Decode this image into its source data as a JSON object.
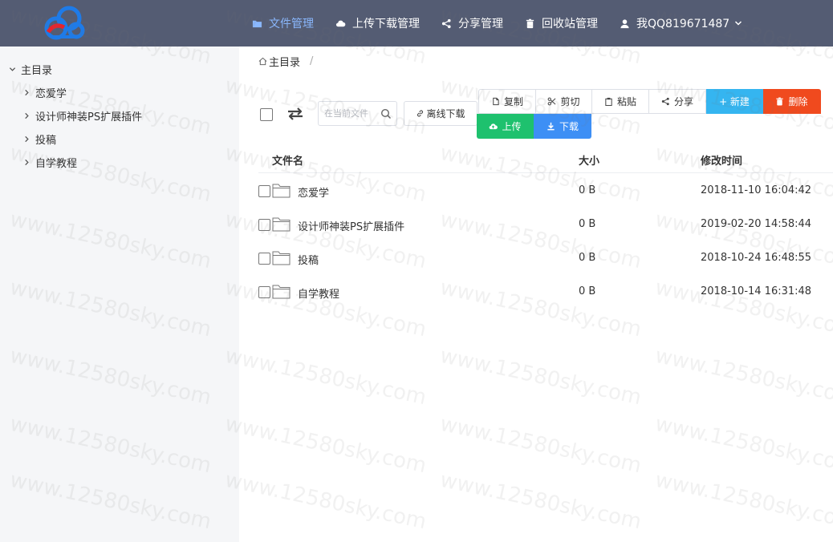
{
  "nav": {
    "items": [
      {
        "label": "文件管理",
        "icon": "folder-icon",
        "active": true
      },
      {
        "label": "上传下载管理",
        "icon": "cloud-icon",
        "active": false
      },
      {
        "label": "分享管理",
        "icon": "share-icon",
        "active": false
      },
      {
        "label": "回收站管理",
        "icon": "trash-icon",
        "active": false
      },
      {
        "label": "我QQ819671487",
        "icon": "user-icon",
        "active": false
      }
    ]
  },
  "sidebar": {
    "root": "主目录",
    "items": [
      {
        "label": "恋爱学"
      },
      {
        "label": "设计师神装PS扩展插件"
      },
      {
        "label": "投稿"
      },
      {
        "label": "自学教程"
      }
    ]
  },
  "breadcrumb": {
    "root": "主目录",
    "separator": "/"
  },
  "search": {
    "placeholder": "在当前文件"
  },
  "offline": {
    "label": "离线下载"
  },
  "toolbar": {
    "copy": "复制",
    "cut": "剪切",
    "paste": "粘贴",
    "share": "分享",
    "new": "+ 新建",
    "delete": "删除",
    "upload": "上传",
    "download": "下载"
  },
  "table": {
    "headers": {
      "name": "文件名",
      "size": "大小",
      "time": "修改时间"
    },
    "rows": [
      {
        "name": "恋爱学",
        "size": "0 B",
        "time": "2018-11-10 16:04:42"
      },
      {
        "name": "设计师神装PS扩展插件",
        "size": "0 B",
        "time": "2019-02-20 14:58:44"
      },
      {
        "name": "投稿",
        "size": "0 B",
        "time": "2018-10-24 16:48:55"
      },
      {
        "name": "自学教程",
        "size": "0 B",
        "time": "2018-10-14 16:31:48"
      }
    ]
  },
  "watermark": "www.12580sky.com",
  "colors": {
    "header_bg": "#545c73",
    "nav_active": "#8ab8ff",
    "sidebar_bg": "#f5f6f8",
    "new_btn": "#35b5f0",
    "delete_btn": "#f04a1e",
    "upload_btn": "#1ec16e",
    "download_btn": "#3d8ff5"
  }
}
